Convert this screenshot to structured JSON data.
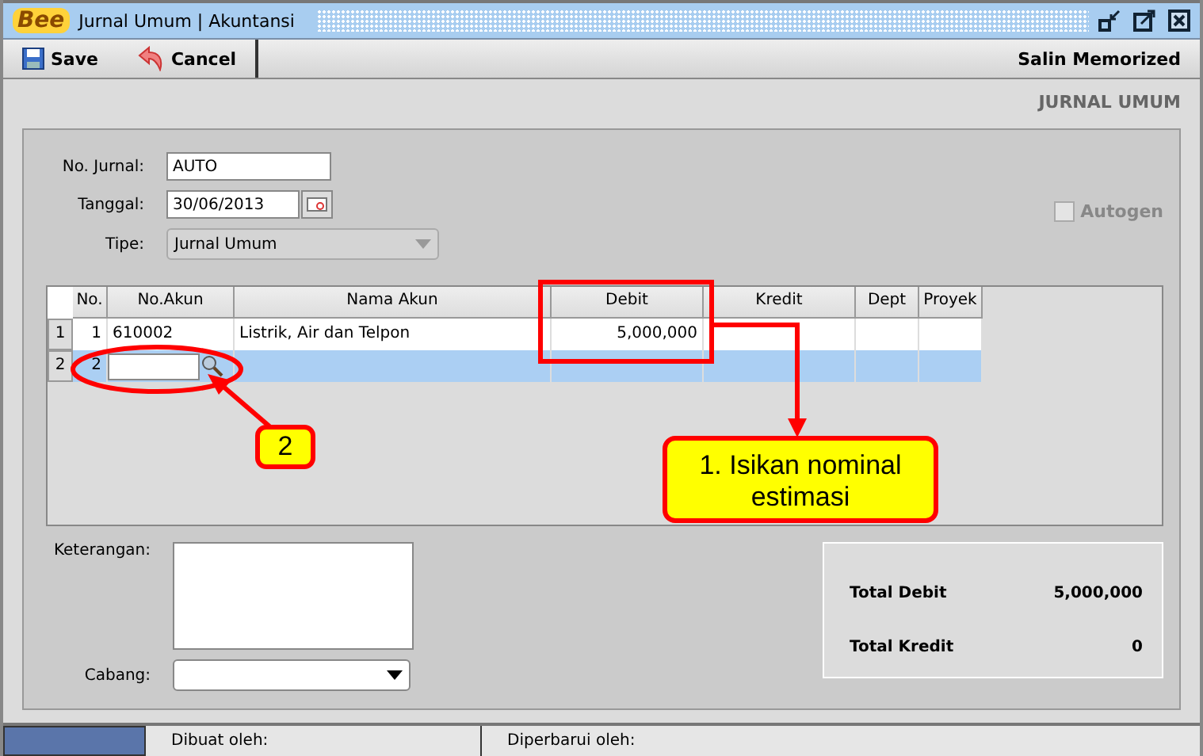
{
  "window": {
    "logo": "Bee",
    "title": "Jurnal Umum | Akuntansi"
  },
  "toolbar": {
    "buttons": [
      {
        "kind": "save",
        "label": "Save"
      },
      {
        "kind": "cancel",
        "label": "Cancel"
      }
    ],
    "right_button": "Salin Memorized"
  },
  "form_title": "JURNAL UMUM",
  "fields": {
    "no_jurnal": {
      "label": "No. Jurnal:",
      "value": "AUTO"
    },
    "tanggal": {
      "label": "Tanggal:",
      "value": "30/06/2013"
    },
    "tipe": {
      "label": "Tipe:",
      "value": "Jurnal Umum",
      "disabled": true
    }
  },
  "autogen": {
    "label": "Autogen",
    "checked": false,
    "disabled": true
  },
  "table": {
    "columns": [
      "No.",
      "No.Akun",
      "Nama Akun",
      "Debit",
      "Kredit",
      "Dept",
      "Proyek"
    ],
    "rows": [
      {
        "header": "1",
        "no": "1",
        "no_akun": "610002",
        "nama_akun": "Listrik, Air dan Telpon",
        "debit": "5,000,000",
        "selected": false,
        "editing": false
      },
      {
        "header": "2",
        "no": "2",
        "no_akun": "",
        "nama_akun": "",
        "debit": "",
        "selected": true,
        "editing": true
      }
    ]
  },
  "keterangan": {
    "label": "Keterangan:"
  },
  "cabang": {
    "label": "Cabang:"
  },
  "totals": [
    {
      "label": "Total Debit",
      "value": "5,000,000"
    },
    {
      "label": "Total Kredit",
      "value": "0"
    }
  ],
  "status_bar": {
    "created": "Dibuat oleh:",
    "updated": "Diperbarui oleh:"
  },
  "annotations": [
    {
      "kind": "callout",
      "text": "1. Isikan nominal estimasi"
    },
    {
      "kind": "badge",
      "text": "2"
    }
  ]
}
